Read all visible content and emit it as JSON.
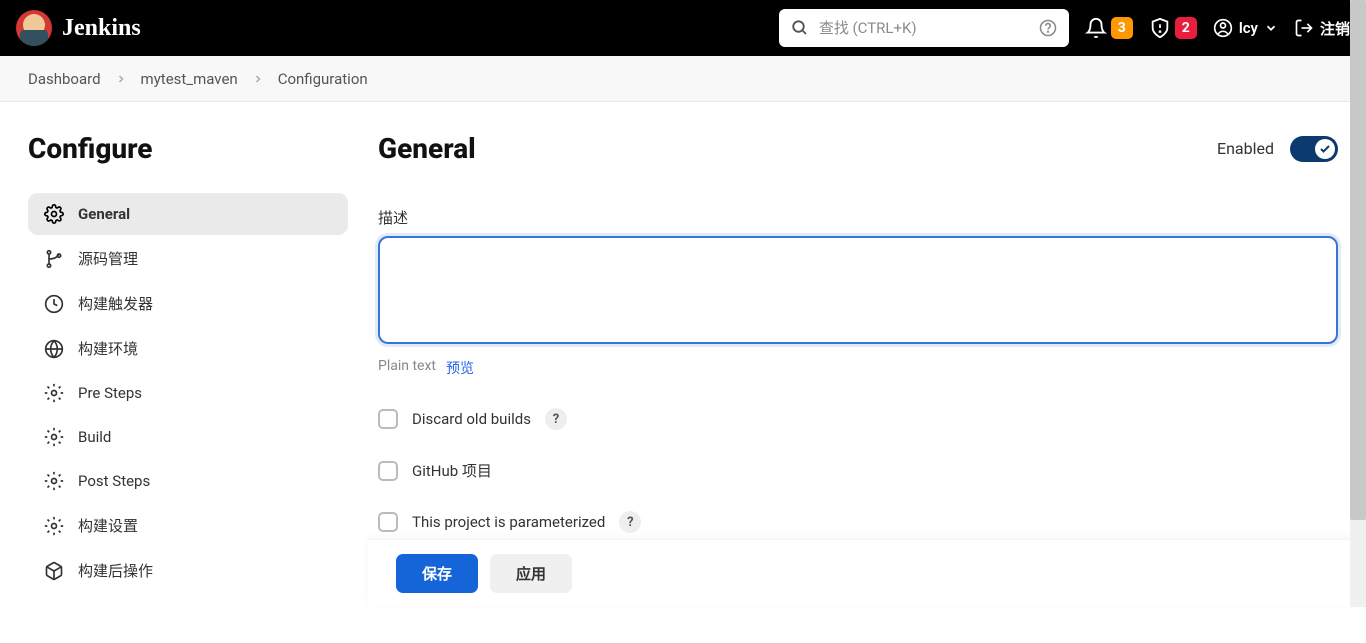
{
  "header": {
    "logo_text": "Jenkins",
    "search_placeholder": "查找 (CTRL+K)",
    "notification_count": "3",
    "security_count": "2",
    "username": "lcy",
    "logout": "注销"
  },
  "breadcrumbs": {
    "items": [
      "Dashboard",
      "mytest_maven",
      "Configuration"
    ]
  },
  "sidebar": {
    "title": "Configure",
    "items": [
      {
        "label": "General",
        "active": true
      },
      {
        "label": "源码管理",
        "active": false
      },
      {
        "label": "构建触发器",
        "active": false
      },
      {
        "label": "构建环境",
        "active": false
      },
      {
        "label": "Pre Steps",
        "active": false
      },
      {
        "label": "Build",
        "active": false
      },
      {
        "label": "Post Steps",
        "active": false
      },
      {
        "label": "构建设置",
        "active": false
      },
      {
        "label": "构建后操作",
        "active": false
      }
    ]
  },
  "content": {
    "title": "General",
    "enabled_label": "Enabled",
    "description_label": "描述",
    "description_value": "",
    "plain_text": "Plain text",
    "preview": "预览",
    "checkboxes": [
      {
        "label": "Discard old builds",
        "help": true
      },
      {
        "label": "GitHub 项目",
        "help": false
      },
      {
        "label": "This project is parameterized",
        "help": true
      }
    ]
  },
  "actions": {
    "save": "保存",
    "apply": "应用"
  }
}
